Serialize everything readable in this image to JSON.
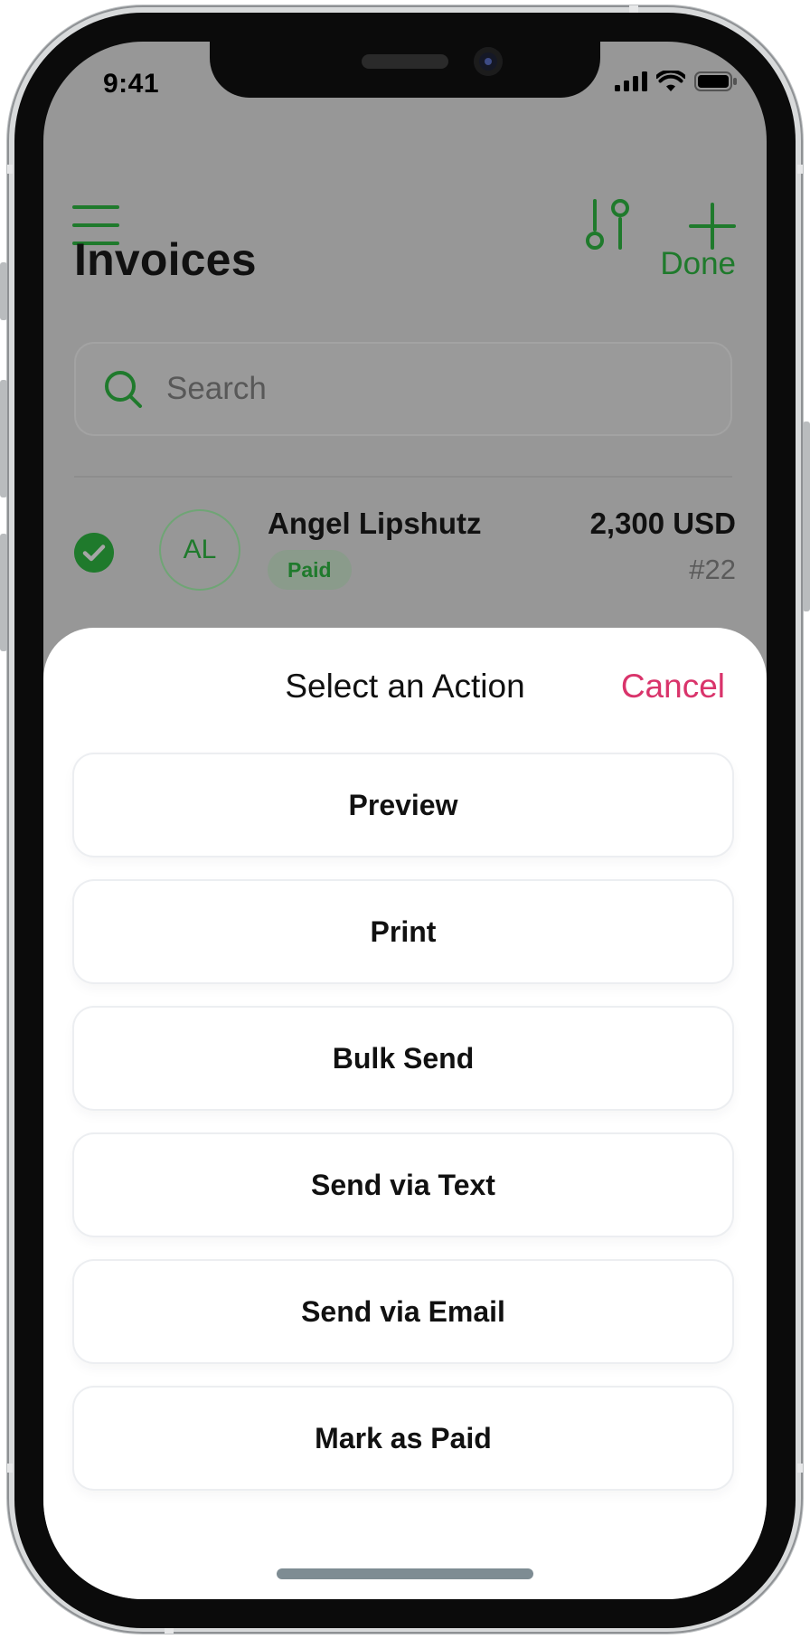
{
  "status_bar": {
    "time": "9:41"
  },
  "header": {
    "title": "Invoices",
    "done_label": "Done"
  },
  "search": {
    "placeholder": "Search"
  },
  "invoice_row": {
    "avatar_initials": "AL",
    "client_name": "Angel Lipshutz",
    "status": "Paid",
    "amount": "2,300 USD",
    "number": "#22"
  },
  "action_sheet": {
    "title": "Select an Action",
    "cancel_label": "Cancel",
    "actions": [
      {
        "label": "Preview"
      },
      {
        "label": "Print"
      },
      {
        "label": "Bulk Send"
      },
      {
        "label": "Send via Text"
      },
      {
        "label": "Send via Email"
      },
      {
        "label": "Mark as Paid"
      }
    ]
  },
  "colors": {
    "accent_green": "#1f7a2c",
    "cancel_pink": "#d9346b",
    "dim_overlay": "#979797"
  },
  "icons": [
    "menu-icon",
    "filter-icon",
    "plus-icon",
    "search-icon",
    "check-circle-icon",
    "signal-icon",
    "wifi-icon",
    "battery-icon"
  ]
}
